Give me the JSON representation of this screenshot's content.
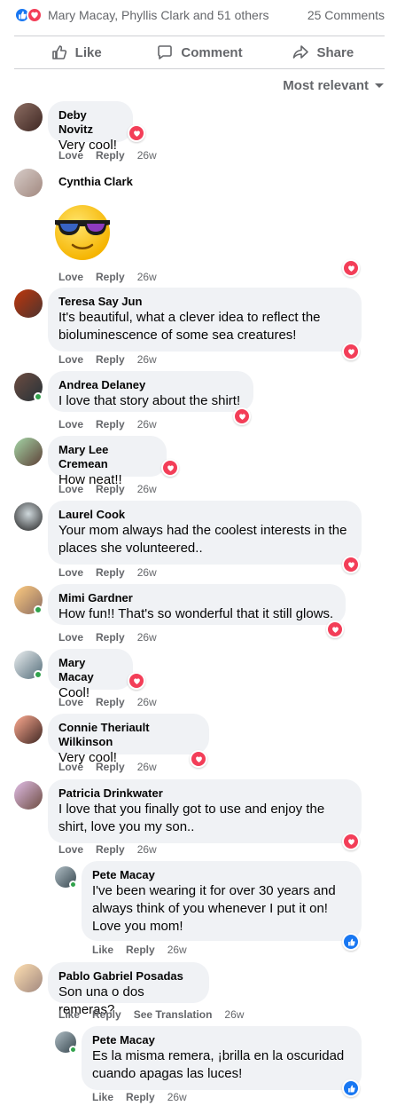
{
  "summary": {
    "names": "Mary Macay, Phyllis Clark and 51 others",
    "comments": "25 Comments"
  },
  "actions": {
    "like": "Like",
    "comment": "Comment",
    "share": "Share"
  },
  "sort": {
    "label": "Most relevant"
  },
  "comments": [
    {
      "author": "Deby Novitz",
      "lines": [
        "Very cool!"
      ],
      "time": "26w"
    },
    {
      "author": "Cynthia Clark",
      "lines": [],
      "sticker": "sunglasses-emoji",
      "time": "26w"
    },
    {
      "author": "Teresa Say Jun",
      "lines": [
        "It's beautiful, what a clever idea to reflect the",
        "bioluminescence of some sea creatures!"
      ],
      "time": "26w"
    },
    {
      "author": "Andrea Delaney",
      "lines": [
        "I love that story about the shirt!"
      ],
      "time": "26w"
    },
    {
      "author": "Mary Lee Cremean",
      "lines": [
        "How neat!!"
      ],
      "time": "26w"
    },
    {
      "author": "Laurel Cook",
      "lines": [
        "Your mom always had the coolest interests in the",
        "places she volunteered.."
      ],
      "time": "26w"
    },
    {
      "author": "Mimi Gardner",
      "lines": [
        "How fun!! That's so wonderful that it still glows."
      ],
      "time": "26w"
    },
    {
      "author": "Mary Macay",
      "lines": [
        "Cool!"
      ],
      "time": "26w"
    },
    {
      "author": "Connie Theriault Wilkinson",
      "lines": [
        "Very cool!"
      ],
      "time": "26w"
    },
    {
      "author": "Patricia Drinkwater",
      "lines": [
        "I love that you finally got to use and enjoy the",
        "shirt, love you my son.."
      ],
      "time": "26w"
    },
    {
      "author": "Pete Macay",
      "lines": [
        "I've been wearing it for over 30 years and",
        "always think of you whenever I put it on!",
        "Love you mom!"
      ],
      "time": "26w"
    },
    {
      "author": "Pablo Gabriel Posadas",
      "lines": [
        "Son una o dos remeras?"
      ],
      "time": "26w",
      "translate": "See Translation"
    },
    {
      "author": "Pete Macay",
      "lines": [
        "Es la misma remera, ¡brilla en la oscuridad",
        "cuando apagas las luces!"
      ],
      "time": "26w"
    }
  ],
  "meta_labels": {
    "love": "Love",
    "like": "Like",
    "reply": "Reply"
  },
  "colors": {
    "like_blue": "#1877f2",
    "love_red": "#f33e58",
    "muted": "#65676b",
    "bubble": "#f0f2f5"
  }
}
